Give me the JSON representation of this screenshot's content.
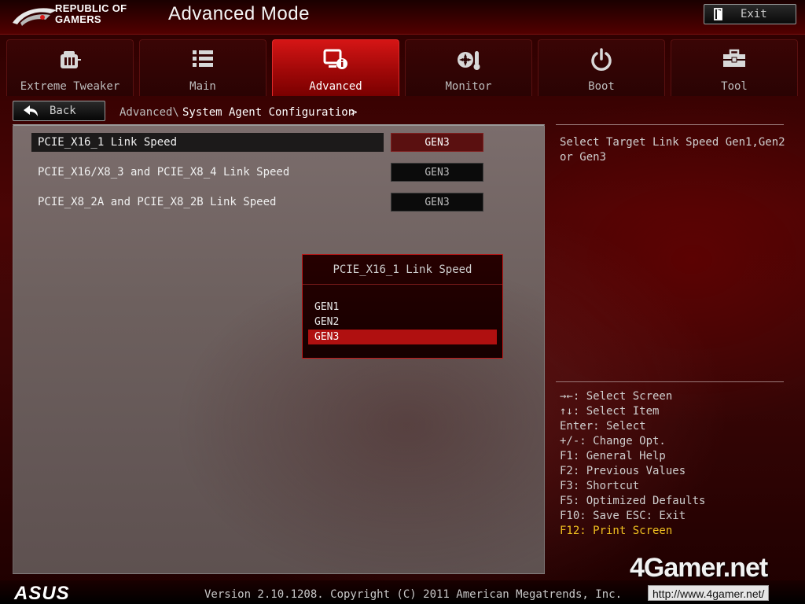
{
  "header": {
    "brand_line1": "REPUBLIC OF",
    "brand_line2": "GAMERS",
    "mode_title": "Advanced Mode",
    "exit_label": "Exit"
  },
  "tabs": [
    {
      "label": "Extreme Tweaker",
      "icon": "tweaker-icon",
      "active": false
    },
    {
      "label": "Main",
      "icon": "list-icon",
      "active": false
    },
    {
      "label": "Advanced",
      "icon": "advanced-info-icon",
      "active": true
    },
    {
      "label": "Monitor",
      "icon": "thermometer-fan-icon",
      "active": false
    },
    {
      "label": "Boot",
      "icon": "power-icon",
      "active": false
    },
    {
      "label": "Tool",
      "icon": "toolbox-icon",
      "active": false
    }
  ],
  "nav": {
    "back_label": "Back",
    "breadcrumb_parent": "Advanced\\",
    "breadcrumb_current": "System Agent Configuration",
    "breadcrumb_arrow": ">"
  },
  "settings": [
    {
      "label": "PCIE_X16_1 Link Speed",
      "value": "GEN3"
    },
    {
      "label": "PCIE_X16/X8_3 and PCIE_X8_4 Link Speed",
      "value": "GEN3"
    },
    {
      "label": "PCIE_X8_2A and PCIE_X8_2B Link Speed",
      "value": "GEN3"
    }
  ],
  "popup": {
    "title": "PCIE_X16_1 Link Speed",
    "options": [
      "GEN1",
      "GEN2",
      "GEN3"
    ],
    "selected": "GEN3"
  },
  "help": {
    "description": "Select Target Link Speed Gen1,Gen2 or Gen3"
  },
  "keys": [
    "→←: Select Screen",
    "↑↓: Select Item",
    "Enter: Select",
    "+/-: Change Opt.",
    "F1: General Help",
    "F2: Previous Values",
    "F3: Shortcut",
    "F5: Optimized Defaults",
    "F10: Save  ESC: Exit",
    "F12: Print Screen"
  ],
  "footer": {
    "brand": "ASUS",
    "version": "Version 2.10.1208. Copyright (C) 2011 American Megatrends, Inc."
  },
  "watermark": {
    "logo": "4Gamer.net",
    "url": "http://www.4gamer.net/"
  },
  "colors": {
    "accent_red": "#b01010",
    "highlight_yellow": "#f0c020"
  }
}
